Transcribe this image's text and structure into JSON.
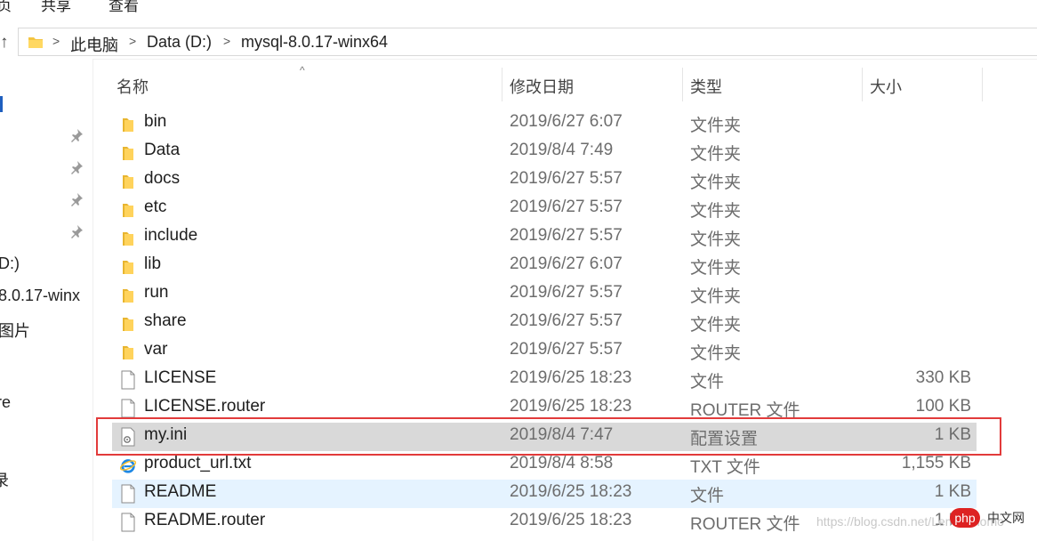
{
  "ribbon": {
    "tabs": [
      "页",
      "共享",
      "查看"
    ]
  },
  "address": {
    "crumbs": [
      "此电脑",
      "Data (D:)",
      "mysql-8.0.17-winx64"
    ]
  },
  "nav": {
    "items": [
      "D:)",
      "8.0.17-winx",
      "图片",
      "re",
      "录"
    ]
  },
  "columns": {
    "name": "名称",
    "date": "修改日期",
    "type": "类型",
    "size": "大小"
  },
  "files": [
    {
      "name": "bin",
      "date": "2019/6/27 6:07",
      "type": "文件夹",
      "size": "",
      "icon": "folder-icon"
    },
    {
      "name": "Data",
      "date": "2019/8/4 7:49",
      "type": "文件夹",
      "size": "",
      "icon": "folder-icon"
    },
    {
      "name": "docs",
      "date": "2019/6/27 5:57",
      "type": "文件夹",
      "size": "",
      "icon": "folder-icon"
    },
    {
      "name": "etc",
      "date": "2019/6/27 5:57",
      "type": "文件夹",
      "size": "",
      "icon": "folder-icon"
    },
    {
      "name": "include",
      "date": "2019/6/27 5:57",
      "type": "文件夹",
      "size": "",
      "icon": "folder-icon"
    },
    {
      "name": "lib",
      "date": "2019/6/27 6:07",
      "type": "文件夹",
      "size": "",
      "icon": "folder-icon"
    },
    {
      "name": "run",
      "date": "2019/6/27 5:57",
      "type": "文件夹",
      "size": "",
      "icon": "folder-icon"
    },
    {
      "name": "share",
      "date": "2019/6/27 5:57",
      "type": "文件夹",
      "size": "",
      "icon": "folder-icon"
    },
    {
      "name": "var",
      "date": "2019/6/27 5:57",
      "type": "文件夹",
      "size": "",
      "icon": "folder-icon"
    },
    {
      "name": "LICENSE",
      "date": "2019/6/25 18:23",
      "type": "文件",
      "size": "330 KB",
      "icon": "file-icon"
    },
    {
      "name": "LICENSE.router",
      "date": "2019/6/25 18:23",
      "type": "ROUTER 文件",
      "size": "100 KB",
      "icon": "file-icon"
    },
    {
      "name": "my.ini",
      "date": "2019/8/4 7:47",
      "type": "配置设置",
      "size": "1 KB",
      "icon": "config-file-icon"
    },
    {
      "name": "product_url.txt",
      "date": "2019/8/4 8:58",
      "type": "TXT 文件",
      "size": "1,155 KB",
      "icon": "internet-explorer-icon"
    },
    {
      "name": "README",
      "date": "2019/6/25 18:23",
      "type": "文件",
      "size": "1 KB",
      "icon": "file-icon"
    },
    {
      "name": "README.router",
      "date": "2019/6/25 18:23",
      "type": "ROUTER 文件",
      "size": "1 KB",
      "icon": "file-icon"
    }
  ],
  "watermark": {
    "url": "https://blog.csdn.net/Lemonmomo",
    "logo": "php",
    "text": "中文网"
  }
}
